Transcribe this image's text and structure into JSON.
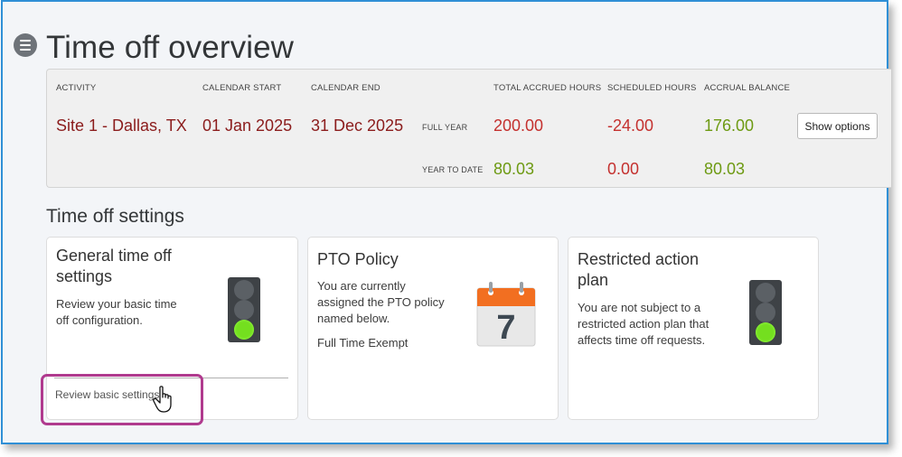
{
  "page": {
    "title": "Time off overview"
  },
  "activity": {
    "headers": {
      "activity": "ACTIVITY",
      "calendar_start": "CALENDAR START",
      "calendar_end": "CALENDAR END",
      "total_accrued": "TOTAL ACCRUED HOURS",
      "scheduled": "SCHEDULED HOURS",
      "balance": "ACCRUAL BALANCE"
    },
    "site": "Site 1 - Dallas, TX",
    "start": "01 Jan 2025",
    "end": "31 Dec 2025",
    "full_year": {
      "label": "FULL YEAR",
      "total_accrued": "200.00",
      "scheduled": "-24.00",
      "balance": "176.00"
    },
    "year_to_date": {
      "label": "YEAR TO DATE",
      "total_accrued": "80.03",
      "scheduled": "0.00",
      "balance": "80.03"
    },
    "show_options_label": "Show options"
  },
  "settings": {
    "section_title": "Time off settings",
    "general": {
      "title_line1": "General time off",
      "title_line2": "settings",
      "desc_line1": "Review your basic time",
      "desc_line2": "off configuration.",
      "link": "Review basic settings"
    },
    "pto": {
      "title": "PTO Policy",
      "desc_line1": "You are currently",
      "desc_line2": "assigned the PTO policy",
      "desc_line3": "named below.",
      "policy_name": "Full Time Exempt",
      "calendar_day": "7"
    },
    "restricted": {
      "title_line1": "Restricted action",
      "title_line2": "plan",
      "desc_line1": "You are not subject to a",
      "desc_line2": "restricted action plan that",
      "desc_line3": "affects time off requests."
    }
  },
  "colors": {
    "frame_border": "#2f8fd6",
    "site_text": "#8b1c1c",
    "negative_value": "#c4302e",
    "positive_value": "#6d9a12",
    "highlight": "#b03a8e",
    "calendar_orange": "#f26f21",
    "traffic_green": "#74df1f"
  },
  "icons": {
    "menu": "hamburger-menu-icon",
    "traffic_light": "traffic-light-green-icon",
    "calendar": "calendar-icon",
    "cursor": "hand-pointer-cursor-icon"
  }
}
